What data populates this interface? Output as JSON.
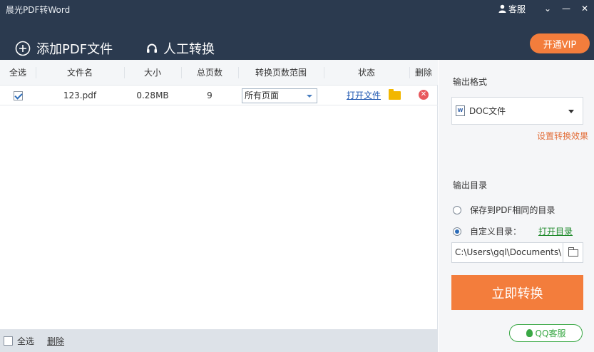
{
  "window": {
    "title": "晨光PDF转Word",
    "service_label": "客服",
    "menu_glyph": "⌄",
    "minimize_glyph": "—",
    "close_glyph": "✕"
  },
  "toolbar": {
    "add_pdf_label": "添加PDF文件",
    "manual_convert_label": "人工转换",
    "vip_label": "开通VIP"
  },
  "table": {
    "headers": [
      "全选",
      "文件名",
      "大小",
      "总页数",
      "转换页数范围",
      "状态",
      "删除"
    ],
    "rows": [
      {
        "checked": true,
        "filename": "123.pdf",
        "size": "0.28MB",
        "pages": "9",
        "range": "所有页面",
        "status_link": "打开文件"
      }
    ]
  },
  "footer": {
    "select_all_label": "全选",
    "delete_label": "删除"
  },
  "panel": {
    "output_format_title": "输出格式",
    "format_value": "DOC文件",
    "format_icon_text": "W",
    "settings_effect_link": "设置转换效果",
    "output_dir_title": "输出目录",
    "option_same_dir": "保存到PDF相同的目录",
    "option_custom_dir": "自定义目录：",
    "open_dir_link": "打开目录",
    "path_value": "C:\\Users\\gql\\Documents\\",
    "convert_button": "立即转换",
    "qq_service": "QQ客服"
  },
  "colors": {
    "header_bg": "#2b3a4f",
    "accent_orange": "#f37d3c",
    "link_blue": "#1c55b0",
    "link_green": "#1f8a2b",
    "qq_green": "#3aa845"
  }
}
